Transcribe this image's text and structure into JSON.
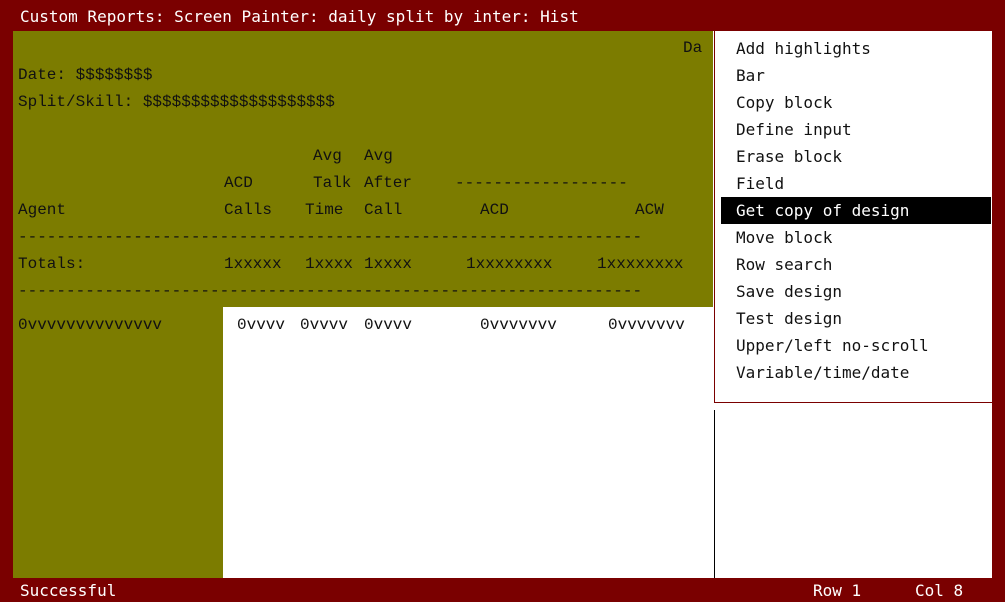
{
  "window": {
    "title": "Custom Reports: Screen Painter: daily split by inter: Hist"
  },
  "report": {
    "header_partial": "Da",
    "date_line": "Date: $$$$$$$$",
    "split_line": "Split/Skill: $$$$$$$$$$$$$$$$$$$$",
    "header_row1": {
      "avg1": "Avg",
      "avg2": "Avg"
    },
    "header_row2": {
      "acd": "ACD",
      "talk": "Talk",
      "after": "After",
      "dashes": "------------------"
    },
    "header_row3": {
      "agent": "Agent",
      "calls": "Calls",
      "time": "Time",
      "call": "Call",
      "acd": "ACD",
      "acw": "ACW"
    },
    "separator": "-----------------------------------------------------------------",
    "totals": {
      "label": "Totals:",
      "calls": "1xxxxx",
      "talk": "1xxxx",
      "after": "1xxxx",
      "acd": "1xxxxxxxx",
      "acw": "1xxxxxxxx"
    },
    "row": {
      "agent": "0vvvvvvvvvvvvvv",
      "calls": "0vvvv",
      "talk": "0vvvv",
      "after": "0vvvv",
      "acd": "0vvvvvvv",
      "acw": "0vvvvvvv"
    }
  },
  "menu": {
    "items": [
      "Add highlights",
      "Bar",
      "Copy block",
      "Define input",
      "Erase block",
      "Field",
      "Get copy of design",
      "Move block",
      "Row search",
      "Save design",
      "Test design",
      "Upper/left no-scroll",
      "Variable/time/date"
    ],
    "selected": "Get copy of design"
  },
  "status": {
    "message": "Successful",
    "row": "Row 1",
    "col": "Col 8"
  },
  "colors": {
    "frame": "#7a0000",
    "olive": "#7c7c00",
    "menu_bg": "#ffffff",
    "selected_bg": "#000000"
  }
}
